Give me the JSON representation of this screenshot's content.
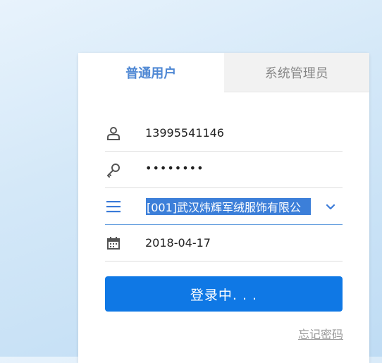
{
  "tabs": [
    {
      "label": "普通用户",
      "active": true
    },
    {
      "label": "系统管理员",
      "active": false
    }
  ],
  "form": {
    "username": "13995541146",
    "password_mask": "••••••••",
    "company": "[001]武汉炜辉军绒服饰有限公",
    "date": "2018-04-17"
  },
  "icons": {
    "user": "user-icon",
    "key": "key-icon",
    "list": "list-icon",
    "calendar": "calendar-icon",
    "chevron": "chevron-down-icon"
  },
  "login_button": "登录中. . .",
  "forgot_link": "忘记密码",
  "colors": {
    "accent": "#4f88d4",
    "button": "#0f78e5",
    "selection": "#3c7fd9"
  }
}
